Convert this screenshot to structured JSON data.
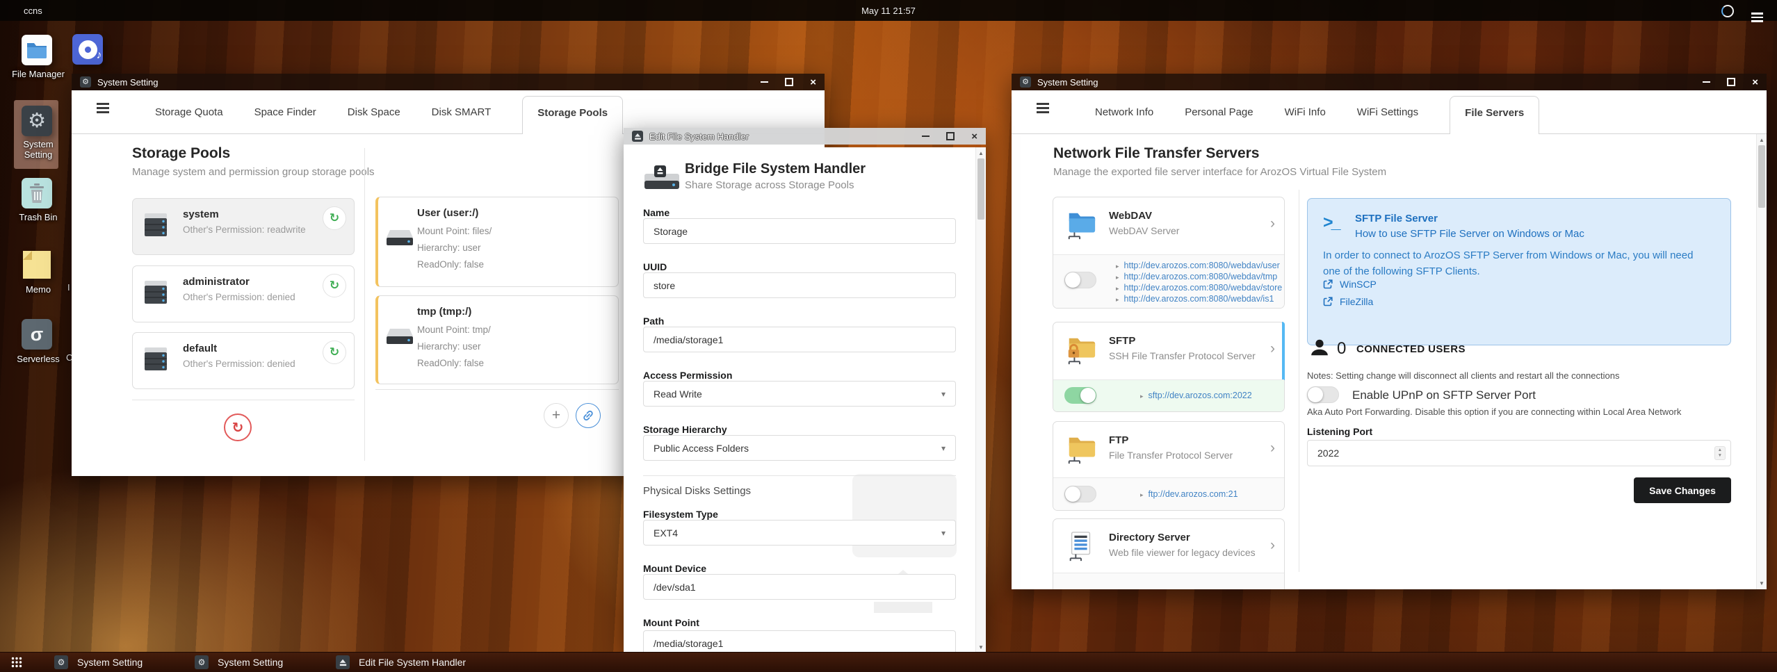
{
  "topbar": {
    "host": "ccns",
    "clock": "May 11 21:57"
  },
  "desktop": {
    "icons": {
      "file_manager": "File Manager",
      "system_setting": "System Setting",
      "trash_bin": "Trash Bin",
      "memo": "Memo",
      "serverless": "Serverless"
    },
    "partial_labels": {
      "a": "I",
      "b": "C"
    }
  },
  "icons": {
    "gear": "⚙",
    "chevron": "›",
    "caret": "▾",
    "bullet": "▸",
    "plus": "+",
    "sync": "↻",
    "refresh": "↻",
    "sigma": "σ",
    "music_note": "♪",
    "terminal": ">_",
    "up": "▲",
    "down": "▼",
    "close": "×",
    "count_zero": "0"
  },
  "window1": {
    "title": "System Setting",
    "tabs": [
      "Storage Quota",
      "Space Finder",
      "Disk Space",
      "Disk SMART",
      "Storage Pools"
    ],
    "heading": "Storage Pools",
    "subheading": "Manage system and permission group storage pools",
    "pools": [
      {
        "name": "system",
        "permission": "Other's Permission: readwrite"
      },
      {
        "name": "administrator",
        "permission": "Other's Permission: denied"
      },
      {
        "name": "default",
        "permission": "Other's Permission: denied"
      }
    ],
    "mounts": [
      {
        "name": "User (user:/)",
        "mount_point": "Mount Point: files/",
        "hierarchy": "Hierarchy: user",
        "readonly": "ReadOnly: false"
      },
      {
        "name": "tmp (tmp:/)",
        "mount_point": "Mount Point: tmp/",
        "hierarchy": "Hierarchy: user",
        "readonly": "ReadOnly: false"
      }
    ]
  },
  "window2": {
    "title": "Edit File System Handler",
    "heading": "Bridge File System Handler",
    "subheading": "Share Storage across Storage Pools",
    "name_label": "Name",
    "name_value": "Storage",
    "uuid_label": "UUID",
    "uuid_value": "store",
    "path_label": "Path",
    "path_value": "/media/storage1",
    "access_label": "Access Permission",
    "access_value": "Read Write",
    "hierarchy_label": "Storage Hierarchy",
    "hierarchy_value": "Public Access Folders",
    "section_title": "Physical Disks Settings",
    "fstype_label": "Filesystem Type",
    "fstype_value": "EXT4",
    "mount_device_label": "Mount Device",
    "mount_device_value": "/dev/sda1",
    "mount_point_label": "Mount Point",
    "mount_point_value": "/media/storage1"
  },
  "window3": {
    "title": "System Setting",
    "tabs": [
      "Network Info",
      "Personal Page",
      "WiFi Info",
      "WiFi Settings",
      "File Servers"
    ],
    "heading": "Network File Transfer Servers",
    "subheading": "Manage the exported file server interface for ArozOS Virtual File System",
    "webdav": {
      "name": "WebDAV",
      "desc": "WebDAV Server",
      "links": [
        "http://dev.arozos.com:8080/webdav/user",
        "http://dev.arozos.com:8080/webdav/tmp",
        "http://dev.arozos.com:8080/webdav/store",
        "http://dev.arozos.com:8080/webdav/is1"
      ]
    },
    "sftp": {
      "name": "SFTP",
      "desc": "SSH File Transfer Protocol Server",
      "link": "sftp://dev.arozos.com:2022"
    },
    "ftp": {
      "name": "FTP",
      "desc": "File Transfer Protocol Server",
      "link": "ftp://dev.arozos.com:21"
    },
    "dirserver": {
      "name": "Directory Server",
      "desc": "Web file viewer for legacy devices"
    },
    "info": {
      "title": "SFTP File Server",
      "subtitle": "How to use SFTP File Server on Windows or Mac",
      "body": "In order to connect to ArozOS SFTP Server from Windows or Mac, you will need one of the following SFTP Clients.",
      "clients": [
        "WinSCP",
        "FileZilla"
      ]
    },
    "connected": {
      "count": "0",
      "label": "CONNECTED USERS",
      "note": "Notes: Setting change will disconnect all clients and restart all the connections"
    },
    "upnp": {
      "label": "Enable UPnP on SFTP Server Port",
      "note": "Aka Auto Port Forwarding. Disable this option if you are connecting within Local Area Network"
    },
    "port_label": "Listening Port",
    "port_value": "2022",
    "save_label": "Save Changes"
  },
  "taskbar": {
    "items": [
      {
        "label": "System Setting"
      },
      {
        "label": "System Setting"
      },
      {
        "label": "Edit File System Handler"
      }
    ]
  },
  "colors": {
    "accent_blue": "#2185d0",
    "link_blue": "#4183c4",
    "toggle_green": "#8ed6a2",
    "selected_card_border": "#55b9f3",
    "save_button": "#1b1c1d",
    "danger_red": "#db2828",
    "success_green": "#3fae54",
    "mount_card_border": "#f3c35f"
  }
}
